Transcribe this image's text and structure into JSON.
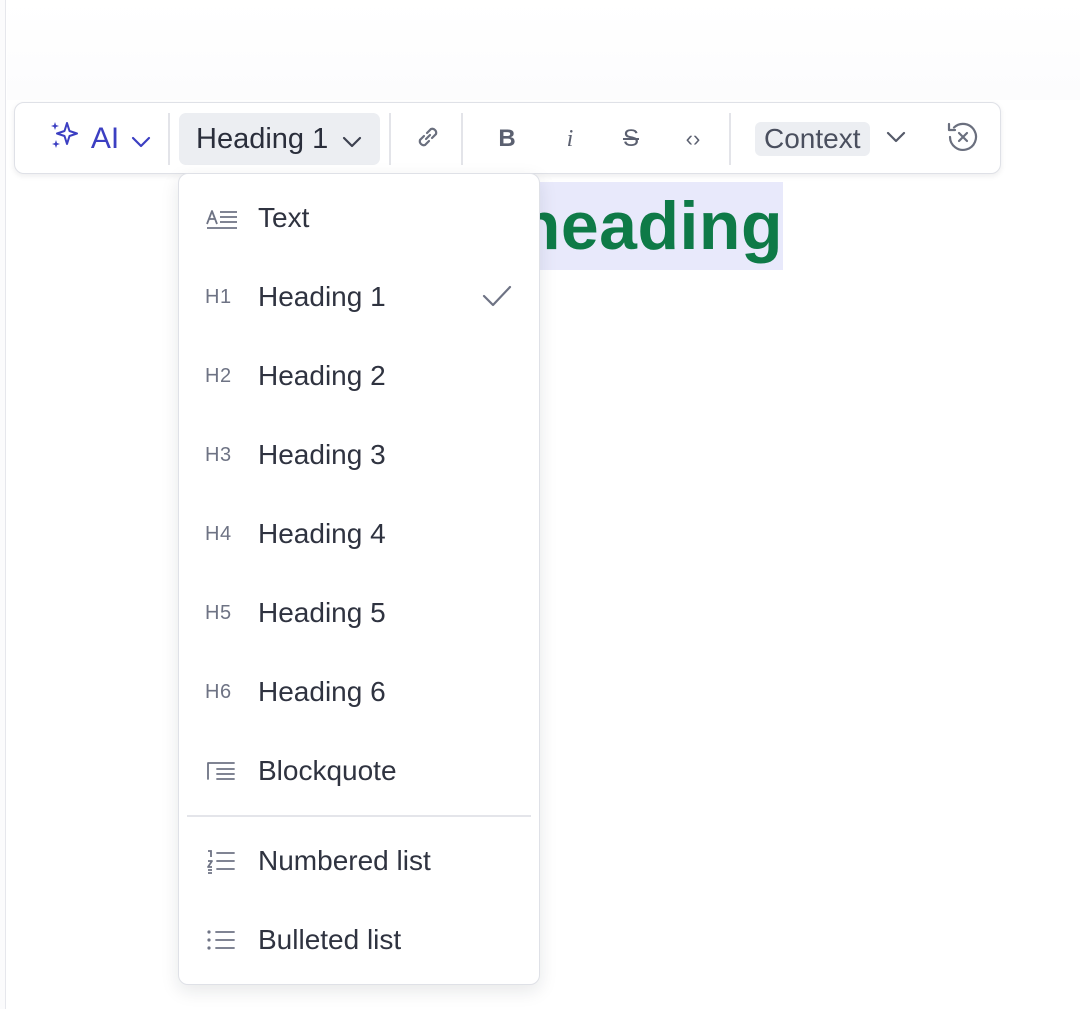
{
  "document": {
    "heading_visible_text": "heading"
  },
  "toolbar": {
    "ai_label": "AI",
    "block_type_label": "Heading 1",
    "context_label": "Context",
    "buttons": {
      "link": "link-icon",
      "bold": "B",
      "italic": "i",
      "strike": "S",
      "code": "‹›",
      "clear": "clear-format-icon"
    }
  },
  "block_menu": {
    "selected": "Heading 1",
    "items": [
      {
        "icon": "text-icon",
        "label": "Text"
      },
      {
        "icon": "H1",
        "label": "Heading 1"
      },
      {
        "icon": "H2",
        "label": "Heading 2"
      },
      {
        "icon": "H3",
        "label": "Heading 3"
      },
      {
        "icon": "H4",
        "label": "Heading 4"
      },
      {
        "icon": "H5",
        "label": "Heading 5"
      },
      {
        "icon": "H6",
        "label": "Heading 6"
      },
      {
        "icon": "blockquote-icon",
        "label": "Blockquote"
      }
    ],
    "list_items": [
      {
        "icon": "numbered-list-icon",
        "label": "Numbered list"
      },
      {
        "icon": "bulleted-list-icon",
        "label": "Bulleted list"
      }
    ]
  },
  "colors": {
    "accent": "#3c3fc2",
    "heading_green": "#0e7a47",
    "selection_bg": "#e8e9fb",
    "chip_bg": "#eceef2"
  }
}
